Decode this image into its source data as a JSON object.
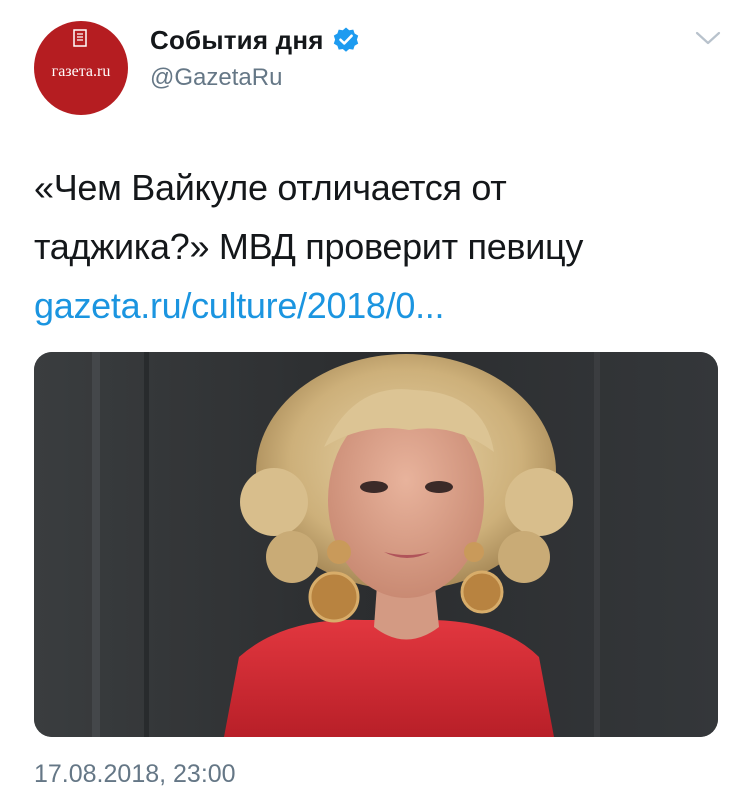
{
  "author": {
    "display_name": "События дня",
    "handle": "@GazetaRu",
    "avatar_text": "газета.ru",
    "verified": true
  },
  "tweet": {
    "text_line1": "«Чем Вайкуле отличается от",
    "text_line2": "таджика?» МВД проверит певицу",
    "link": "gazeta.ru/culture/2018/0..."
  },
  "media": {
    "kind": "photo",
    "subject": "woman with curly blonde hair, large round earrings, red blouse, dark background"
  },
  "timestamp": "17.08.2018, 23:00",
  "colors": {
    "avatar_bg": "#b51d21",
    "link": "#1b95e0",
    "verified": "#1d9bf0",
    "secondary_text": "#657786"
  },
  "icons": [
    "verified-badge-icon",
    "chevron-down-icon",
    "newspaper-logo-icon"
  ]
}
